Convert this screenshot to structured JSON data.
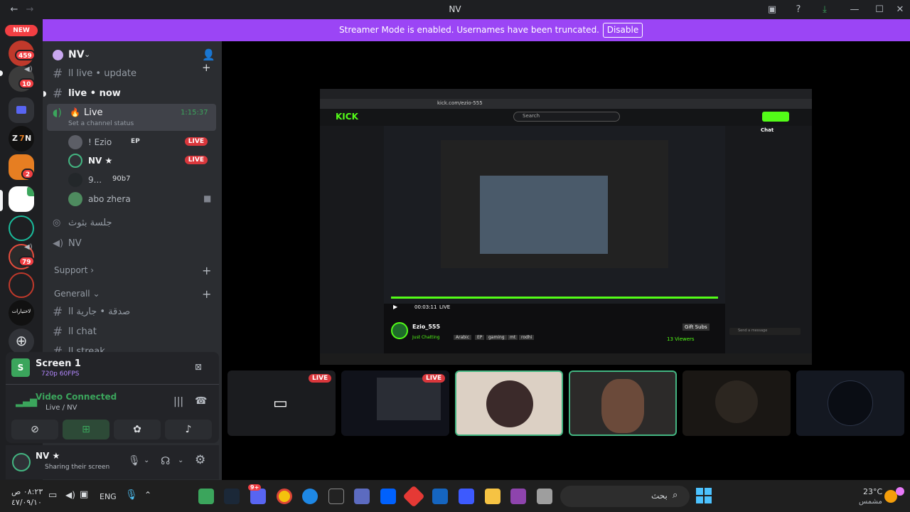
{
  "titlebar": {
    "title": "NV"
  },
  "banner": {
    "message": "Streamer Mode is enabled. Usernames have been truncated.",
    "button": "Disable"
  },
  "rail": {
    "new_badge": "NEW",
    "badges": {
      "g1": "459",
      "g2": "10",
      "g5": "2",
      "g8": "79"
    },
    "last_label": "لاختيارات"
  },
  "sidebar": {
    "server_name": "NV",
    "channels": {
      "update": "اا live • update",
      "now": "live • now",
      "live_voice": "Live",
      "live_timer": "1:15:37",
      "live_status": "Set a channel status",
      "stage": "جلسة بثوث",
      "nv": "NV",
      "support": "Support",
      "general": "Generall",
      "sadaqa": "صدقة • جارية اا",
      "chat": "اا chat",
      "streak": "اا streak"
    },
    "voice_users": [
      {
        "name": "! Ezio",
        "extra": "EP",
        "live": "LIVE"
      },
      {
        "name": "NV ★",
        "extra": "",
        "live": "LIVE"
      },
      {
        "name": "9...",
        "extra": "90b7",
        "live": ""
      },
      {
        "name": "abo zhera",
        "extra": "",
        "live": ""
      }
    ]
  },
  "rtc": {
    "screen_title": "Screen 1",
    "screen_quality": "720p 60FPS",
    "status": "Video Connected",
    "channel": "Live / NV"
  },
  "user": {
    "name": "NV ★",
    "status": "Sharing their screen"
  },
  "stage": {
    "tiles": [
      {
        "live": "LIVE"
      },
      {
        "live": "LIVE"
      }
    ],
    "stream": {
      "site": "KICK",
      "url": "kick.com/ezio-555",
      "search": "Search",
      "channel": "Ezio_555",
      "category": "Just Chatting",
      "tags": [
        "Arabic",
        "EP",
        "gaming",
        "mt",
        "rodhi"
      ],
      "viewers": "13 Viewers",
      "chat_title": "Chat",
      "chat_placeholder": "Send a message",
      "gift": "Gift Subs",
      "live": "LIVE",
      "time": "00:03:11"
    }
  },
  "taskbar": {
    "time": "٠٨:٢٣ ص",
    "date": "٤٧/٠٩/١٠",
    "lang": "ENG",
    "search": "بحث",
    "weather_temp": "23°C",
    "weather_desc": "مشمس",
    "discord_badge": "9+"
  }
}
